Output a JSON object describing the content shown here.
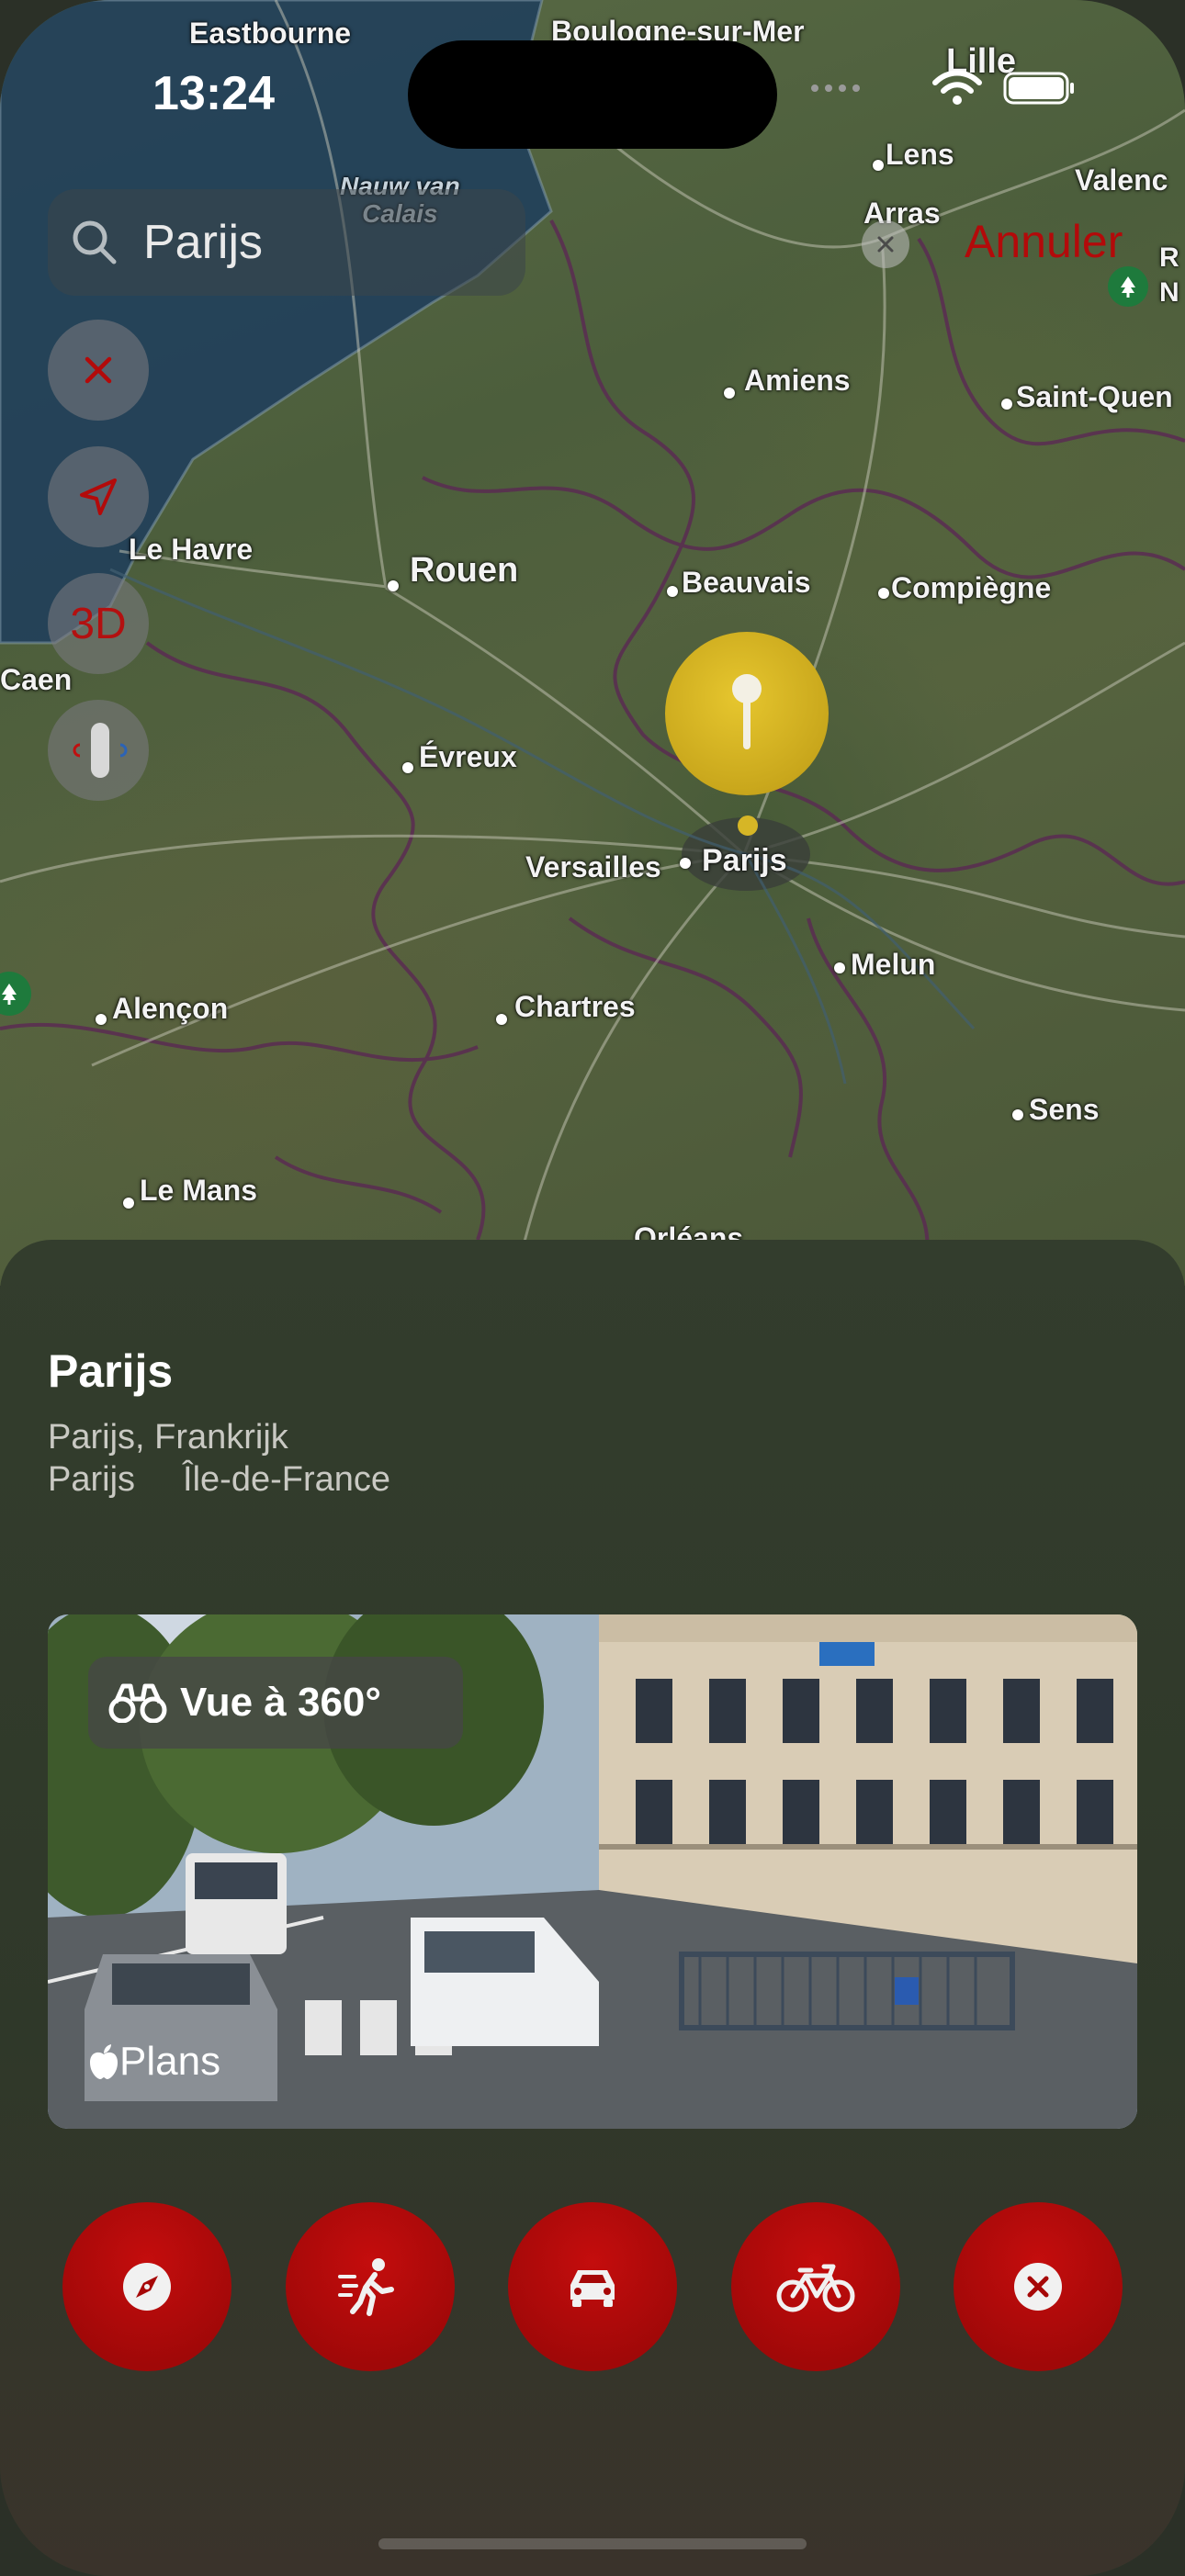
{
  "status": {
    "time": "13:24"
  },
  "search": {
    "value": "Parijs",
    "cancel_label": "Annuler"
  },
  "map": {
    "three_d_label": "3D",
    "selected_pin_label": "Parijs",
    "labels": {
      "eastbourne": "Eastbourne",
      "boulogne": "Boulogne-sur-Mer",
      "lille": "Lille",
      "lens": "Lens",
      "arras": "Arras",
      "valenc": "Valenc",
      "nauw": "Nauw van\nCalais",
      "rn": "R\nN",
      "amiens": "Amiens",
      "saint_quentin": "Saint-Quen",
      "le_havre": "Le Havre",
      "rouen": "Rouen",
      "beauvais": "Beauvais",
      "compiegne": "Compiègne",
      "caen": "Caen",
      "evreux": "Évreux",
      "versailles": "Versailles",
      "melun": "Melun",
      "alencon": "Alençon",
      "chartres": "Chartres",
      "sens": "Sens",
      "le_mans": "Le Mans",
      "orleans": "Orléans"
    }
  },
  "place": {
    "title": "Parijs",
    "subtitle": "Parijs, Frankrijk",
    "locality": "Parijs",
    "region": "Île-de-France"
  },
  "look_around": {
    "label": "Vue à 360°",
    "brand": "Plans"
  },
  "actions": [
    {
      "name": "compass",
      "icon": "compass-icon"
    },
    {
      "name": "walk",
      "icon": "walking-icon"
    },
    {
      "name": "drive",
      "icon": "car-icon"
    },
    {
      "name": "bike",
      "icon": "bicycle-icon"
    },
    {
      "name": "close",
      "icon": "close-icon"
    }
  ],
  "colors": {
    "accent": "#b30a0a",
    "pin": "#d4b324",
    "sea": "#1f3b52"
  }
}
